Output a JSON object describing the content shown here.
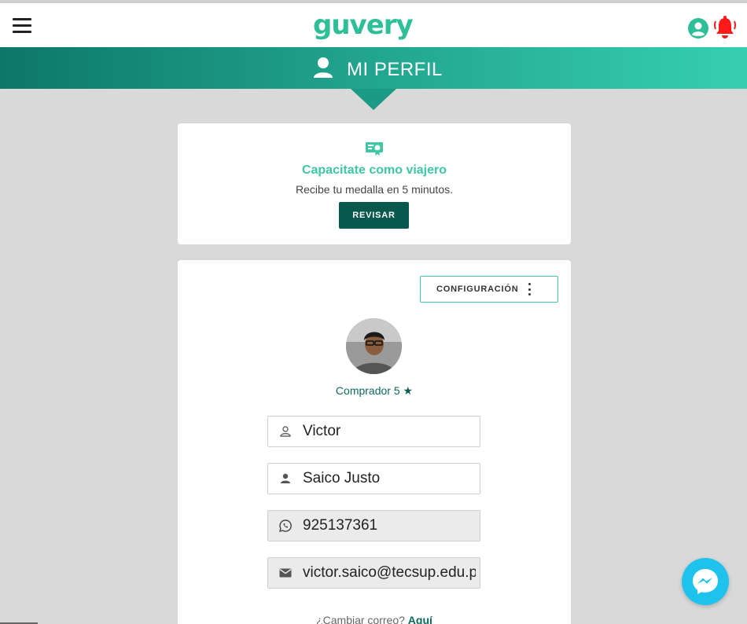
{
  "header": {
    "logo": "guvery",
    "menu_icon": "hamburger-menu-icon",
    "user_icon": "user-circle-icon",
    "bell_icon": "bell-icon",
    "colors": {
      "logo": "#2ebf98",
      "bell": "#ff1a1a",
      "user": "#2ebf98"
    }
  },
  "profile_bar": {
    "title": "MI PERFIL",
    "icon": "user-icon"
  },
  "training_card": {
    "icon": "certificate-icon",
    "title": "Capacitate como viajero",
    "subtitle": "Recibe tu medalla en 5 minutos.",
    "button_label": "REVISAR"
  },
  "profile_card": {
    "config_label": "CONFIGURACIÓN",
    "role": "Comprador 5",
    "fields": [
      {
        "icon": "person-outline-icon",
        "value": "Victor",
        "disabled": false
      },
      {
        "icon": "person-icon",
        "value": "Saico Justo",
        "disabled": false
      },
      {
        "icon": "whatsapp-icon",
        "value": "925137361",
        "disabled": true
      },
      {
        "icon": "mail-icon",
        "value": "victor.saico@tecsup.edu.pe",
        "disabled": true
      }
    ],
    "change_mail_text": "¿Cambiar correo?",
    "change_mail_link": "Aquí"
  },
  "messenger_icon": "messenger-icon",
  "colors": {
    "accent": "#3ec6a6",
    "dark": "#07584d",
    "background": "#d9d9d9"
  }
}
